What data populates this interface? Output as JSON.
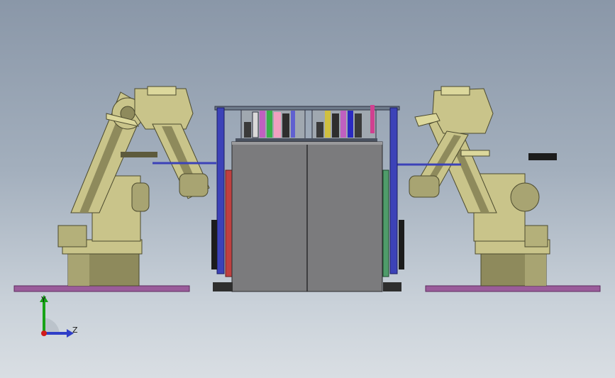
{
  "triad": {
    "y_label": "Y",
    "z_label": "Z"
  },
  "colors": {
    "robot_body": "#c9c48a",
    "robot_shadow": "#8e8a5c",
    "robot_dark": "#5d5a3c",
    "base_plate": "#9a5c9a",
    "cabinet_front": "#7b7b7d",
    "frame_blue": "#3c42b8",
    "axis_y": "#17a317",
    "axis_z": "#2f3ec8",
    "axis_origin": "#d11a1a"
  }
}
